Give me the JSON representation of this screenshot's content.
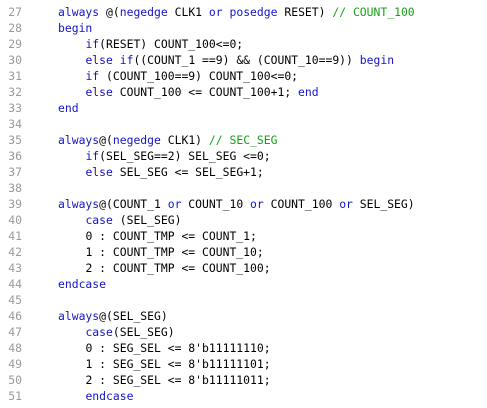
{
  "theme": {
    "background": "#ffffff",
    "line_number_color": "#9a9a9a",
    "keyword_color": "#1414c8",
    "comment_color": "#14a014",
    "text_color": "#000000"
  },
  "lines": [
    {
      "n": "27",
      "indent": "",
      "tokens": [
        {
          "t": "always ",
          "k": "kw"
        },
        {
          "t": "@(",
          "k": "tx"
        },
        {
          "t": "negedge",
          "k": "kw"
        },
        {
          "t": " CLK1 ",
          "k": "tx"
        },
        {
          "t": "or",
          "k": "kw"
        },
        {
          "t": " ",
          "k": "tx"
        },
        {
          "t": "posedge",
          "k": "kw"
        },
        {
          "t": " RESET) ",
          "k": "tx"
        },
        {
          "t": "// COUNT_100",
          "k": "cm"
        }
      ]
    },
    {
      "n": "28",
      "indent": "",
      "tokens": [
        {
          "t": "begin",
          "k": "kw"
        }
      ]
    },
    {
      "n": "29",
      "indent": "    ",
      "tokens": [
        {
          "t": "if",
          "k": "kw"
        },
        {
          "t": "(RESET) COUNT_100<=0;",
          "k": "tx"
        }
      ]
    },
    {
      "n": "30",
      "indent": "    ",
      "tokens": [
        {
          "t": "else",
          "k": "kw"
        },
        {
          "t": " ",
          "k": "tx"
        },
        {
          "t": "if",
          "k": "kw"
        },
        {
          "t": "((COUNT_1 ==9) && (COUNT_10==9)) ",
          "k": "tx"
        },
        {
          "t": "begin",
          "k": "kw"
        }
      ]
    },
    {
      "n": "31",
      "indent": "    ",
      "tokens": [
        {
          "t": "if",
          "k": "kw"
        },
        {
          "t": " (COUNT_100==9) COUNT_100<=0;",
          "k": "tx"
        }
      ]
    },
    {
      "n": "32",
      "indent": "    ",
      "tokens": [
        {
          "t": "else",
          "k": "kw"
        },
        {
          "t": " COUNT_100 <= COUNT_100+1; ",
          "k": "tx"
        },
        {
          "t": "end",
          "k": "kw"
        }
      ]
    },
    {
      "n": "33",
      "indent": "",
      "tokens": [
        {
          "t": "end",
          "k": "kw"
        }
      ]
    },
    {
      "n": "34",
      "indent": "",
      "tokens": []
    },
    {
      "n": "35",
      "indent": "",
      "tokens": [
        {
          "t": "always",
          "k": "kw"
        },
        {
          "t": "@(",
          "k": "tx"
        },
        {
          "t": "negedge",
          "k": "kw"
        },
        {
          "t": " CLK1) ",
          "k": "tx"
        },
        {
          "t": "// SEC_SEG",
          "k": "cm"
        }
      ]
    },
    {
      "n": "36",
      "indent": "    ",
      "tokens": [
        {
          "t": "if",
          "k": "kw"
        },
        {
          "t": "(SEL_SEG==2) SEL_SEG <=0;",
          "k": "tx"
        }
      ]
    },
    {
      "n": "37",
      "indent": "    ",
      "tokens": [
        {
          "t": "else",
          "k": "kw"
        },
        {
          "t": " SEL_SEG <= SEL_SEG+1;",
          "k": "tx"
        }
      ]
    },
    {
      "n": "38",
      "indent": "",
      "tokens": []
    },
    {
      "n": "39",
      "indent": "",
      "tokens": [
        {
          "t": "always",
          "k": "kw"
        },
        {
          "t": "@(COUNT_1 ",
          "k": "tx"
        },
        {
          "t": "or",
          "k": "kw"
        },
        {
          "t": " COUNT_10 ",
          "k": "tx"
        },
        {
          "t": "or",
          "k": "kw"
        },
        {
          "t": " COUNT_100 ",
          "k": "tx"
        },
        {
          "t": "or",
          "k": "kw"
        },
        {
          "t": " SEL_SEG)",
          "k": "tx"
        }
      ]
    },
    {
      "n": "40",
      "indent": "    ",
      "tokens": [
        {
          "t": "case",
          "k": "kw"
        },
        {
          "t": " (SEL_SEG)",
          "k": "tx"
        }
      ]
    },
    {
      "n": "41",
      "indent": "    ",
      "tokens": [
        {
          "t": "0 : COUNT_TMP <= COUNT_1;",
          "k": "tx"
        }
      ]
    },
    {
      "n": "42",
      "indent": "    ",
      "tokens": [
        {
          "t": "1 : COUNT_TMP <= COUNT_10;",
          "k": "tx"
        }
      ]
    },
    {
      "n": "43",
      "indent": "    ",
      "tokens": [
        {
          "t": "2 : COUNT_TMP <= COUNT_100;",
          "k": "tx"
        }
      ]
    },
    {
      "n": "44",
      "indent": "",
      "tokens": [
        {
          "t": "endcase",
          "k": "kw"
        }
      ]
    },
    {
      "n": "45",
      "indent": "",
      "tokens": []
    },
    {
      "n": "46",
      "indent": "",
      "tokens": [
        {
          "t": "always",
          "k": "kw"
        },
        {
          "t": "@(SEL_SEG)",
          "k": "tx"
        }
      ]
    },
    {
      "n": "47",
      "indent": "    ",
      "tokens": [
        {
          "t": "case",
          "k": "kw"
        },
        {
          "t": "(SEL_SEG)",
          "k": "tx"
        }
      ]
    },
    {
      "n": "48",
      "indent": "    ",
      "tokens": [
        {
          "t": "0 : SEG_SEL <= 8'b11111110;",
          "k": "tx"
        }
      ]
    },
    {
      "n": "49",
      "indent": "    ",
      "tokens": [
        {
          "t": "1 : SEG_SEL <= 8'b11111101;",
          "k": "tx"
        }
      ]
    },
    {
      "n": "50",
      "indent": "    ",
      "tokens": [
        {
          "t": "2 : SEG_SEL <= 8'b11111011;",
          "k": "tx"
        }
      ]
    },
    {
      "n": "51",
      "indent": "    ",
      "tokens": [
        {
          "t": "endcase",
          "k": "kw"
        }
      ]
    }
  ]
}
